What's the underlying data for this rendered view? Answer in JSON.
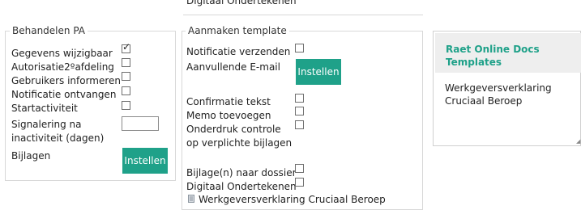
{
  "top_cutoff": {
    "label": "Digitaal Ondertekenen"
  },
  "behandelen": {
    "legend": "Behandelen PA",
    "fields": [
      {
        "label": "Gegevens wijzigbaar",
        "checked": true
      },
      {
        "label": "Autorisatie2ºafdeling",
        "checked": false
      },
      {
        "label": "Gebruikers informeren",
        "checked": false
      },
      {
        "label": "Notificatie ontvangen",
        "checked": false
      },
      {
        "label": "Startactiviteit",
        "checked": false
      }
    ],
    "signalering_line1": "Signalering na",
    "signalering_line2": "inactiviteit (dagen)",
    "signalering_value": "",
    "bijlagen_label": "Bijlagen",
    "instellen_label": "Instellen"
  },
  "aanmaken": {
    "legend": "Aanmaken template",
    "notificatie_label": "Notificatie verzenden",
    "aanvullende_label": "Aanvullende E-mail",
    "instellen_label": "Instellen",
    "confirmatie_label": "Confirmatie tekst",
    "memo_label": "Memo toevoegen",
    "onderdruk_line1": "Onderdruk controle",
    "onderdruk_line2": "op verplichte bijlagen",
    "bijlage_dossier_label": "Bijlage(n) naar dossier",
    "digitaal_label": "Digitaal Ondertekenen",
    "attachment_label": "Werkgeversverklaring Cruciaal Beroep",
    "attachment_icon": "document-icon"
  },
  "docs_panel": {
    "title": "Raet Online Docs Templates",
    "item": "Werkgeversverklaring Cruciaal Beroep",
    "title_color": "#1fa189"
  },
  "colors": {
    "accent": "#1fa189"
  }
}
